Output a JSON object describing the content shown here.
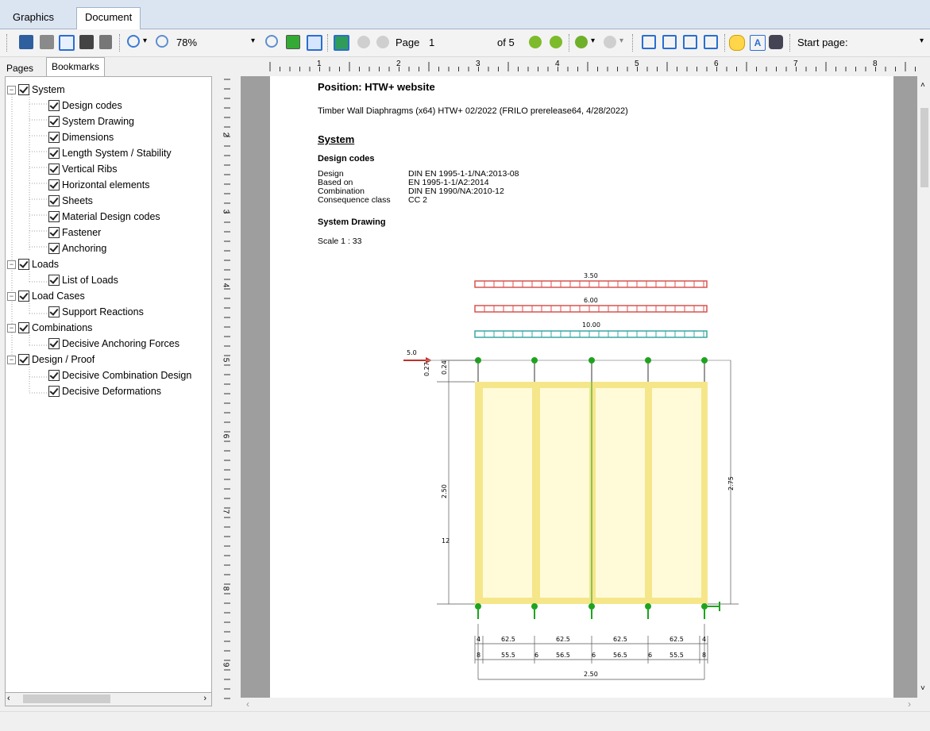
{
  "tabs": {
    "graphics": "Graphics",
    "document": "Document"
  },
  "toolbar": {
    "zoom": "78%",
    "page_label": "Page",
    "page_value": "1",
    "of_pages": "of 5",
    "start_page": "Start page:"
  },
  "pane_tabs": {
    "pages": "Pages",
    "bookmarks": "Bookmarks"
  },
  "tree": {
    "system": "System",
    "design_codes": "Design codes",
    "system_drawing": "System Drawing",
    "dimensions": "Dimensions",
    "length_system": "Length System / Stability",
    "vertical_ribs": "Vertical Ribs",
    "horizontal_elements": "Horizontal elements",
    "sheets": "Sheets",
    "material_design_codes": "Material Design codes",
    "fastener": "Fastener",
    "anchoring": "Anchoring",
    "loads": "Loads",
    "list_of_loads": "List of Loads",
    "load_cases": "Load Cases",
    "support_reactions": "Support Reactions",
    "combinations": "Combinations",
    "decisive_anchoring": "Decisive Anchoring Forces",
    "design_proof": "Design / Proof",
    "decisive_combination": "Decisive Combination Design",
    "decisive_deformations": "Decisive Deformations"
  },
  "ruler": {
    "h_labels": [
      "1",
      "2",
      "3",
      "4",
      "5",
      "6",
      "7",
      "8"
    ],
    "v_labels": [
      "2",
      "3",
      "4",
      "5",
      "6",
      "7",
      "8",
      "9"
    ]
  },
  "doc": {
    "position": "Position: HTW+ website",
    "subtitle": "Timber Wall Diaphragms (x64) HTW+ 02/2022  (FRILO prerelease64, 4/28/2022)",
    "section_system": "System",
    "design_codes_heading": "Design codes",
    "codes": [
      {
        "label": "Design",
        "value": "DIN EN 1995-1-1/NA:2013-08"
      },
      {
        "label": "Based on",
        "value": "EN 1995-1-1/A2:2014"
      },
      {
        "label": "Combination",
        "value": "DIN EN 1990/NA:2010-12"
      },
      {
        "label": "Consequence class",
        "value": "CC 2"
      }
    ],
    "system_drawing_heading": "System Drawing",
    "scale": "Scale 1 : 33"
  },
  "drawing": {
    "loads": [
      "3.50",
      "6.00",
      "10.00"
    ],
    "horizontal_load": "5.0",
    "dim_left_top": "0.27",
    "dim_left_top2": "0.24",
    "dim_left_height": "2.50",
    "dim_left_12": "12",
    "dim_right_height": "2.75",
    "dims_row1": [
      "4",
      "62.5",
      "62.5",
      "62.5",
      "62.5",
      "4"
    ],
    "dims_row2": [
      "8",
      "55.5",
      "6",
      "56.5",
      "6",
      "56.5",
      "6",
      "55.5",
      "8"
    ],
    "dim_total": "2.50",
    "colors": {
      "red_load": "#d9534f",
      "teal_load": "#3aa7a3",
      "panel_fill": "#fffbd9",
      "frame": "#f5e68a",
      "node": "#1fa31f"
    }
  }
}
